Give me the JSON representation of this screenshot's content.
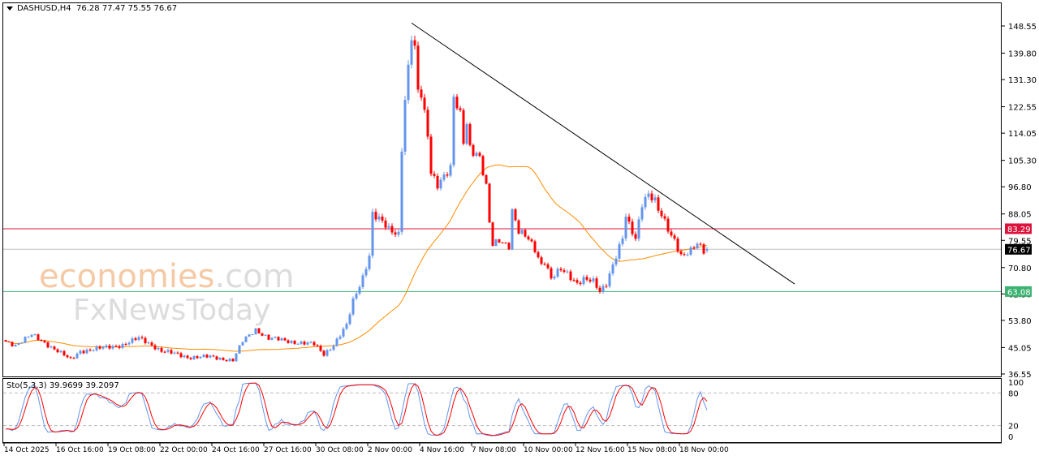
{
  "header": {
    "symbol": "DASHUSD,H4",
    "ohlc": "76.28 77.47 75.55 76.67"
  },
  "watermark": {
    "brand1_main": "economies",
    "brand1_tld": ".com",
    "brand2": "FxNewsToday"
  },
  "indicator": {
    "label": "Sto(5,3,3) 39.9699 39.2097",
    "levels": [
      "100",
      "80",
      "20",
      "0"
    ]
  },
  "colors": {
    "bull": "#6495ED",
    "bear": "#FF0000",
    "ma": "#FF8C00",
    "resistance": "#DC143C",
    "support": "#3CB371",
    "current": "#C0C0C0",
    "trendline": "#000000",
    "sto_main": "#6495ED",
    "sto_signal": "#FF0000"
  },
  "chart_data": {
    "type": "candlestick",
    "symbol": "DASHUSD",
    "timeframe": "H4",
    "last_bar": {
      "open": 76.28,
      "high": 77.47,
      "low": 75.55,
      "close": 76.67
    },
    "ylim": [
      36.55,
      152.5
    ],
    "y_ticks": [
      "148.55",
      "139.80",
      "131.30",
      "122.55",
      "114.05",
      "105.30",
      "96.80",
      "88.05",
      "79.55",
      "70.80",
      "62.30",
      "53.80",
      "45.05",
      "36.55"
    ],
    "x_ticks": [
      {
        "bar": 0,
        "label": "14 Oct 2025"
      },
      {
        "bar": 16,
        "label": "16 Oct 16:00"
      },
      {
        "bar": 32,
        "label": "19 Oct 08:00"
      },
      {
        "bar": 48,
        "label": "22 Oct 00:00"
      },
      {
        "bar": 64,
        "label": "24 Oct 16:00"
      },
      {
        "bar": 80,
        "label": "27 Oct 16:00"
      },
      {
        "bar": 96,
        "label": "30 Oct 08:00"
      },
      {
        "bar": 112,
        "label": "2 Nov 00:00"
      },
      {
        "bar": 128,
        "label": "4 Nov 16:00"
      },
      {
        "bar": 144,
        "label": "7 Nov 08:00"
      },
      {
        "bar": 160,
        "label": "10 Nov 00:00"
      },
      {
        "bar": 176,
        "label": "12 Nov 16:00"
      },
      {
        "bar": 192,
        "label": "15 Nov 08:00"
      },
      {
        "bar": 208,
        "label": "18 Nov 00:00"
      }
    ],
    "bar_count": 217,
    "close_path": [
      [
        0,
        47
      ],
      [
        3,
        46
      ],
      [
        8,
        49
      ],
      [
        13,
        46
      ],
      [
        16,
        44
      ],
      [
        20,
        41
      ],
      [
        23,
        44
      ],
      [
        31,
        45
      ],
      [
        36,
        46
      ],
      [
        41,
        48
      ],
      [
        45,
        46
      ],
      [
        48,
        44
      ],
      [
        56,
        42
      ],
      [
        63,
        42
      ],
      [
        70,
        41
      ],
      [
        73,
        47
      ],
      [
        77,
        51
      ],
      [
        81,
        48
      ],
      [
        88,
        47
      ],
      [
        95,
        46
      ],
      [
        98,
        43
      ],
      [
        101,
        46
      ],
      [
        105,
        52
      ],
      [
        107,
        60
      ],
      [
        110,
        68
      ],
      [
        112,
        75
      ],
      [
        113,
        88
      ],
      [
        116,
        85
      ],
      [
        118,
        83
      ],
      [
        121,
        82
      ],
      [
        122,
        110
      ],
      [
        123,
        125
      ],
      [
        125,
        145
      ],
      [
        126,
        140
      ],
      [
        127,
        127
      ],
      [
        128,
        126
      ],
      [
        130,
        114
      ],
      [
        131,
        102
      ],
      [
        133,
        98
      ],
      [
        135,
        100
      ],
      [
        137,
        102
      ],
      [
        138,
        125
      ],
      [
        140,
        120
      ],
      [
        141,
        112
      ],
      [
        142,
        118
      ],
      [
        143,
        110
      ],
      [
        146,
        106
      ],
      [
        148,
        96
      ],
      [
        149,
        85
      ],
      [
        150,
        78
      ],
      [
        152,
        80
      ],
      [
        155,
        78
      ],
      [
        156,
        89
      ],
      [
        158,
        82
      ],
      [
        161,
        80
      ],
      [
        163,
        77
      ],
      [
        165,
        72
      ],
      [
        166,
        73
      ],
      [
        168,
        67
      ],
      [
        171,
        70
      ],
      [
        173,
        69
      ],
      [
        176,
        66
      ],
      [
        178,
        67
      ],
      [
        181,
        66
      ],
      [
        183,
        63
      ],
      [
        185,
        66
      ],
      [
        187,
        72
      ],
      [
        190,
        80
      ],
      [
        191,
        87
      ],
      [
        192,
        84
      ],
      [
        194,
        80
      ],
      [
        196,
        92
      ],
      [
        198,
        95
      ],
      [
        200,
        92
      ],
      [
        201,
        89
      ],
      [
        203,
        85
      ],
      [
        205,
        81
      ],
      [
        206,
        80
      ],
      [
        208,
        75
      ],
      [
        211,
        76
      ],
      [
        213,
        78
      ],
      [
        215,
        76
      ],
      [
        216,
        76.67
      ]
    ],
    "moving_average_period": 40,
    "horizontal_lines": [
      {
        "price": 83.29,
        "label": "83.29",
        "role": "resistance"
      },
      {
        "price": 76.67,
        "label": "76.67",
        "role": "current"
      },
      {
        "price": 63.08,
        "label": "63.08",
        "role": "support"
      }
    ],
    "trendline": {
      "from": {
        "bar": 125,
        "price": 149.5
      },
      "to": {
        "bar": 243,
        "price": 65.5
      }
    },
    "stochastic": {
      "k": 5,
      "d": 3,
      "slowing": 3,
      "main": 39.9699,
      "signal": 39.2097,
      "levels": [
        80,
        20
      ]
    }
  }
}
